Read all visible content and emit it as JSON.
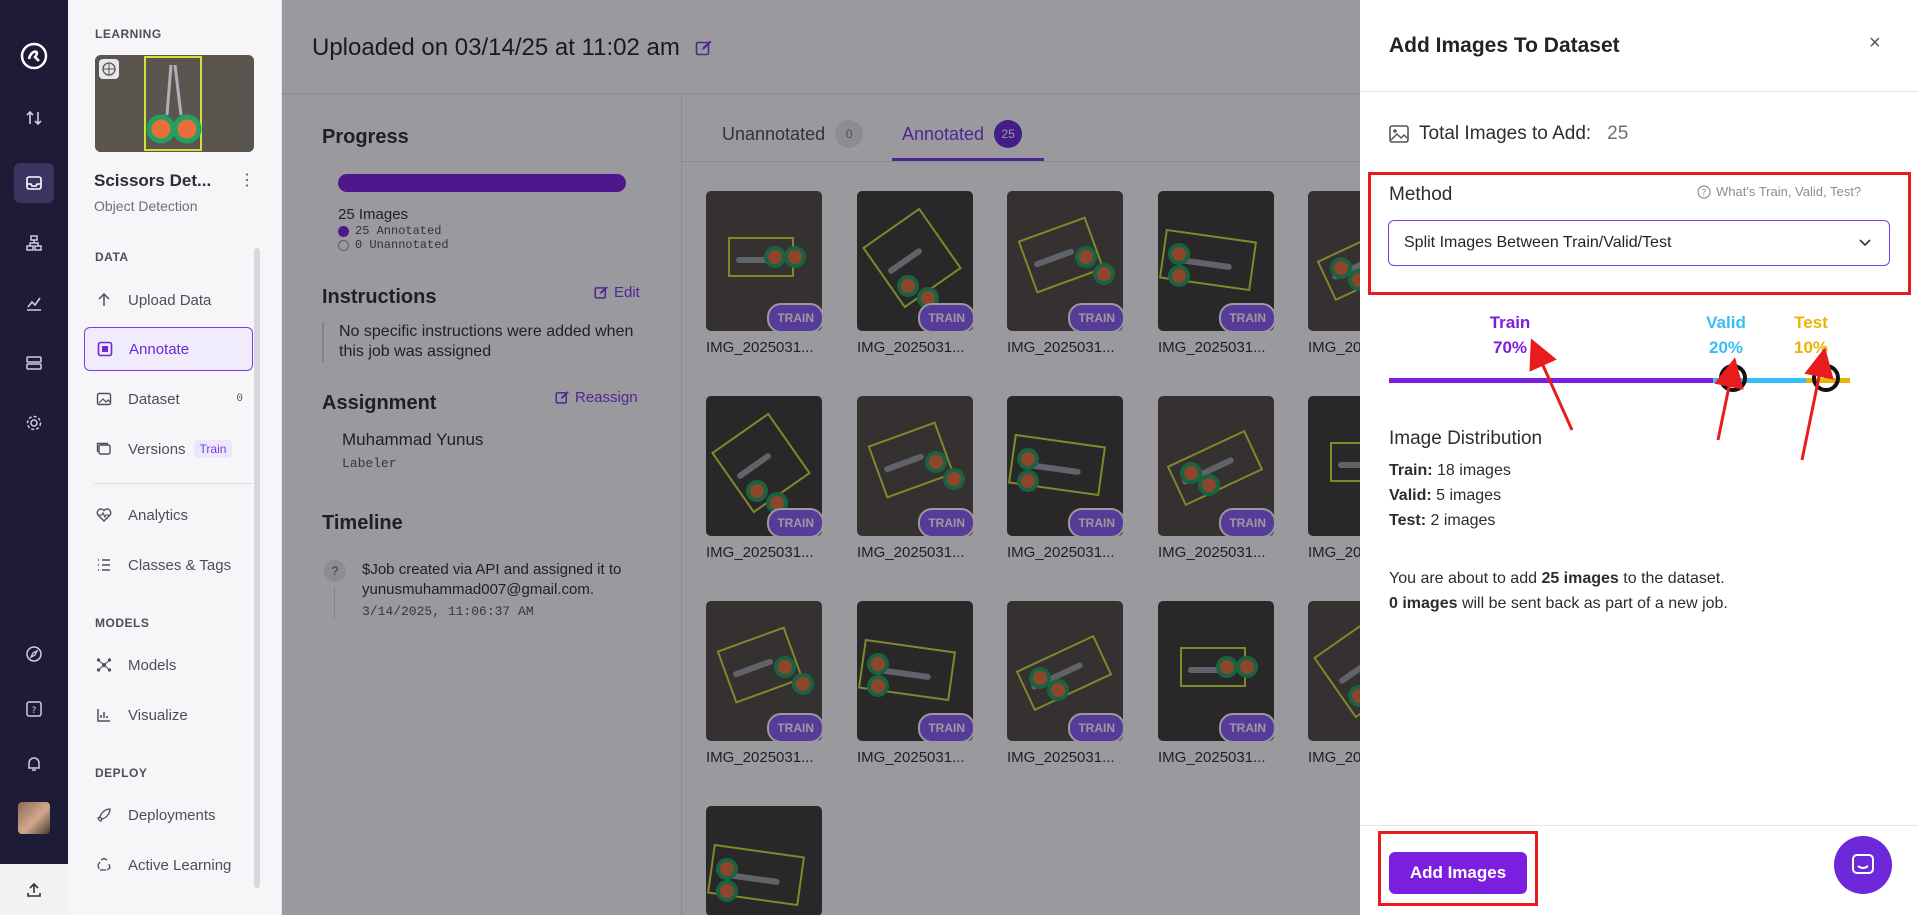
{
  "rail": {
    "icons": [
      "logo-icon",
      "sort-icon",
      "inbox-icon",
      "workflow-icon",
      "chart-icon",
      "storage-icon",
      "settings-icon",
      "compass-icon",
      "help-icon",
      "bell-icon",
      "upload-icon"
    ]
  },
  "sidebar": {
    "learning_title": "LEARNING",
    "project_name": "Scissors Det...",
    "project_type": "Object Detection",
    "data_title": "DATA",
    "models_title": "MODELS",
    "deploy_title": "DEPLOY",
    "items": [
      {
        "label": "Upload Data",
        "icon": "upload-arrow-icon"
      },
      {
        "label": "Annotate",
        "icon": "annotate-icon",
        "active": true
      },
      {
        "label": "Dataset",
        "icon": "image-icon",
        "badge": "0"
      },
      {
        "label": "Versions",
        "icon": "versions-icon",
        "tag": "Train"
      },
      {
        "label": "Analytics",
        "icon": "heart-pulse-icon"
      },
      {
        "label": "Classes & Tags",
        "icon": "list-icon"
      },
      {
        "label": "Models",
        "icon": "network-icon"
      },
      {
        "label": "Visualize",
        "icon": "bar-chart-icon"
      },
      {
        "label": "Deployments",
        "icon": "rocket-icon"
      },
      {
        "label": "Active Learning",
        "icon": "recycle-icon"
      }
    ]
  },
  "header": {
    "title": "Uploaded on 03/14/25 at 11:02 am"
  },
  "left_panel": {
    "progress_title": "Progress",
    "progress_fraction": 1.0,
    "images_count": "25 Images",
    "annotated_line": "25 Annotated",
    "unannotated_line": "0 Unannotated",
    "instructions_title": "Instructions",
    "edit_label": "Edit",
    "instructions_text": "No specific instructions were added when this job was assigned",
    "assignment_title": "Assignment",
    "reassign_label": "Reassign",
    "assignee_name": "Muhammad Yunus",
    "assignee_role": "Labeler",
    "timeline_title": "Timeline",
    "timeline_marker": "?",
    "timeline_text": "$Job created via API and assigned it to yunusmuhammad007@gmail.com.",
    "timeline_time": "3/14/2025, 11:06:37 AM"
  },
  "tabs": [
    {
      "label": "Unannotated",
      "count": "0"
    },
    {
      "label": "Annotated",
      "count": "25",
      "active": true
    }
  ],
  "images": {
    "badge": "TRAIN",
    "name": "IMG_2025031...",
    "name_cut": "IMG_20"
  },
  "drawer": {
    "title": "Add Images To Dataset",
    "close": "×",
    "total_label": "Total Images to Add:",
    "total_value": "25",
    "method_label": "Method",
    "method_help": "What's Train, Valid, Test?",
    "method_value": "Split Images Between Train/Valid/Test",
    "split": {
      "train_label": "Train",
      "train_pct": "70%",
      "valid_label": "Valid",
      "valid_pct": "20%",
      "test_label": "Test",
      "test_pct": "10%",
      "colors": {
        "train": "#7c1ee0",
        "valid": "#38bdf8",
        "test": "#eab308"
      }
    },
    "distribution_title": "Image Distribution",
    "train_key": "Train:",
    "train_val": "18 images",
    "valid_key": "Valid:",
    "valid_val": "5 images",
    "test_key": "Test:",
    "test_val": "2 images",
    "about_1": "You are about to add",
    "about_bold": "25 images",
    "about_2": "to the dataset.",
    "sent_bold": "0 images",
    "sent_rest": "will be sent back as part of a new job.",
    "add_button": "Add Images"
  },
  "colors": {
    "accent": "#7c3aed",
    "highlight": "#e81c1c",
    "rail": "#1e1b36"
  }
}
